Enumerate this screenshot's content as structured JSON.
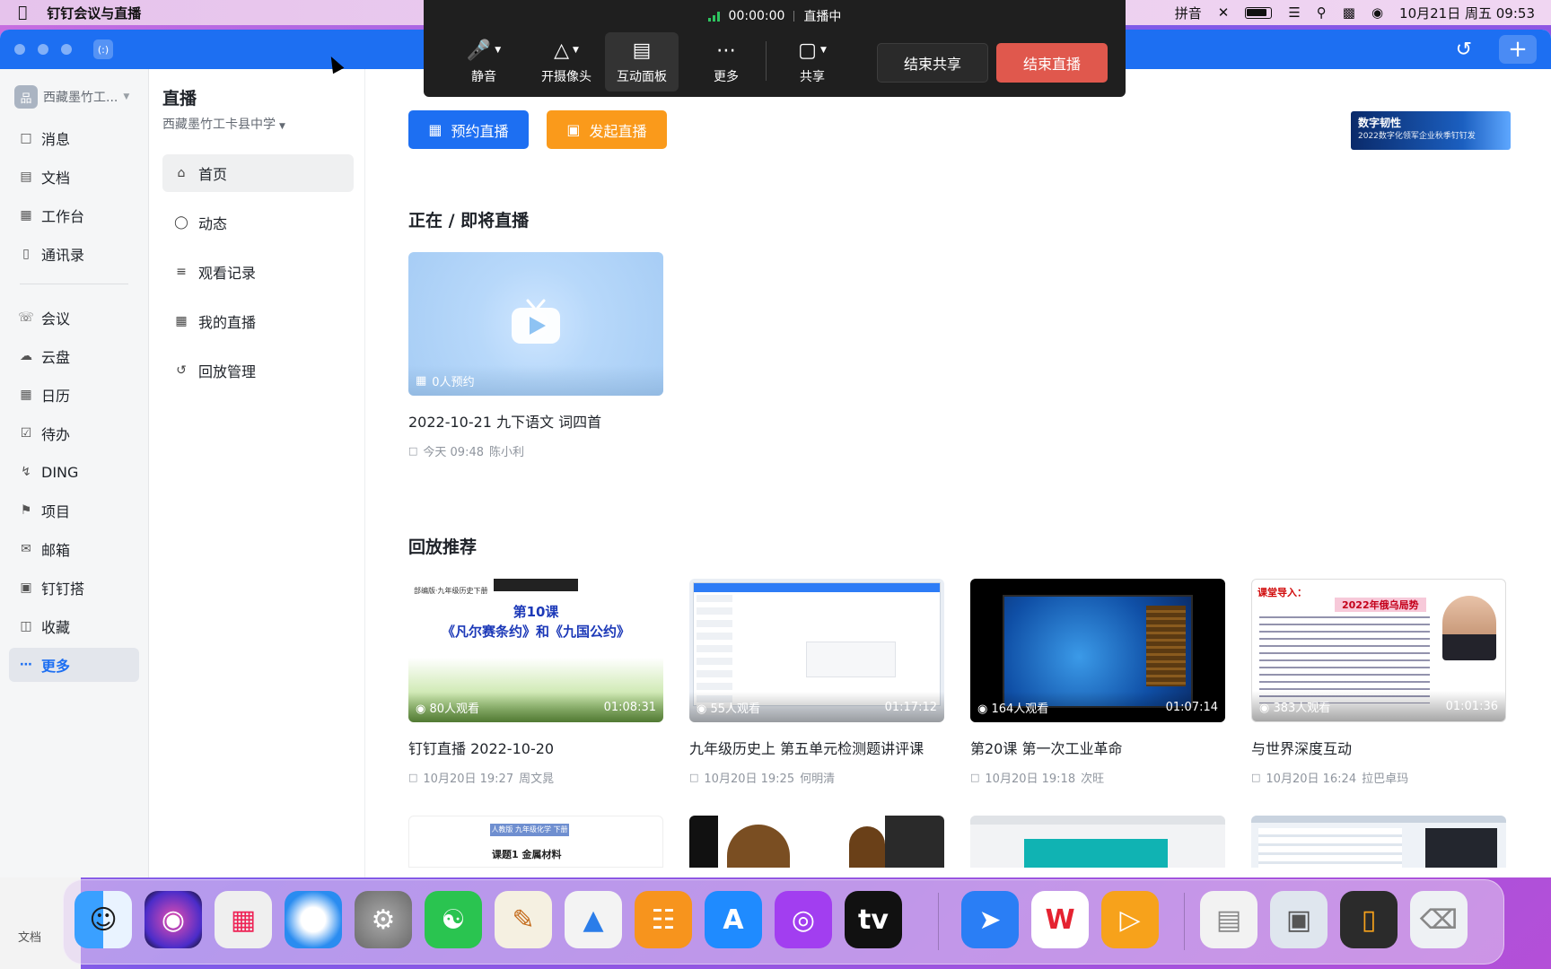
{
  "menubar": {
    "app_name": "钉钉会议与直播",
    "input_method": "拼音",
    "datetime": "10月21日 周五 09:53"
  },
  "window": {
    "logo_text": "(:)"
  },
  "sidebar": {
    "org_name": "西藏墨竹工...",
    "org_avatar": "品",
    "items": [
      {
        "label": "消息",
        "icon": "message-icon"
      },
      {
        "label": "文档",
        "icon": "document-icon"
      },
      {
        "label": "工作台",
        "icon": "workbench-icon"
      },
      {
        "label": "通讯录",
        "icon": "contacts-icon"
      },
      {
        "label": "会议",
        "icon": "meeting-icon"
      },
      {
        "label": "云盘",
        "icon": "cloud-icon"
      },
      {
        "label": "日历",
        "icon": "calendar-icon"
      },
      {
        "label": "待办",
        "icon": "todo-icon"
      },
      {
        "label": "DING",
        "icon": "lightning-icon"
      },
      {
        "label": "项目",
        "icon": "project-icon"
      },
      {
        "label": "邮箱",
        "icon": "mail-icon"
      },
      {
        "label": "钉钉搭",
        "icon": "builder-icon"
      },
      {
        "label": "收藏",
        "icon": "favorites-icon"
      },
      {
        "label": "更多",
        "icon": "more-icon"
      }
    ]
  },
  "subnav": {
    "title": "直播",
    "org": "西藏墨竹工卡县中学",
    "items": [
      {
        "label": "首页",
        "icon": "home-icon"
      },
      {
        "label": "动态",
        "icon": "chat-icon"
      },
      {
        "label": "观看记录",
        "icon": "history-list-icon"
      },
      {
        "label": "我的直播",
        "icon": "tv-icon"
      },
      {
        "label": "回放管理",
        "icon": "replay-icon"
      }
    ]
  },
  "main": {
    "schedule_btn": "预约直播",
    "start_btn": "发起直播",
    "banner_line1": "数字韧性",
    "banner_line2": "2022数字化领军企业秋季钉钉发",
    "live_section": "正在 / 即将直播",
    "live_card": {
      "reservations": "0人预约",
      "title": "2022-10-21 九下语文 词四首",
      "time": "今天 09:48",
      "host": "陈小利"
    },
    "replay_section": "回放推荐",
    "replays": [
      {
        "title": "钉钉直播 2022-10-20",
        "viewers": "80人观看",
        "duration": "01:08:31",
        "time": "10月20日 19:27",
        "host": "周文晁",
        "slide_top": "部编版·九年级历史下册",
        "slide_title_1": "第10课",
        "slide_title_2": "《凡尔赛条约》和《九国公约》"
      },
      {
        "title": "九年级历史上 第五单元检测题讲评课",
        "viewers": "55人观看",
        "duration": "01:17:12",
        "time": "10月20日 19:25",
        "host": "何明清"
      },
      {
        "title": "第20课 第一次工业革命",
        "viewers": "164人观看",
        "duration": "01:07:14",
        "time": "10月20日 19:18",
        "host": "次旺"
      },
      {
        "title": "与世界深度互动",
        "viewers": "383人观看",
        "duration": "01:01:36",
        "time": "10月20日 16:24",
        "host": "拉巴卓玛",
        "slide_hdr": "课堂导入：",
        "slide_hdr2": "2022年俄乌局势"
      }
    ],
    "row2_label_1": "人教版 九年级化学 下册",
    "row2_label_2": "课题1 金属材料"
  },
  "live_toolbar": {
    "timer": "00:00:00",
    "status": "直播中",
    "mute": "静音",
    "camera": "开摄像头",
    "panel": "互动面板",
    "more": "更多",
    "share": "共享",
    "end_share": "结束共享",
    "end_live": "结束直播"
  },
  "dock": {
    "peek_label": "文档"
  },
  "colors": {
    "accent": "#1d6ff2",
    "orange": "#fa9a1b",
    "end_live": "#e0584d"
  }
}
